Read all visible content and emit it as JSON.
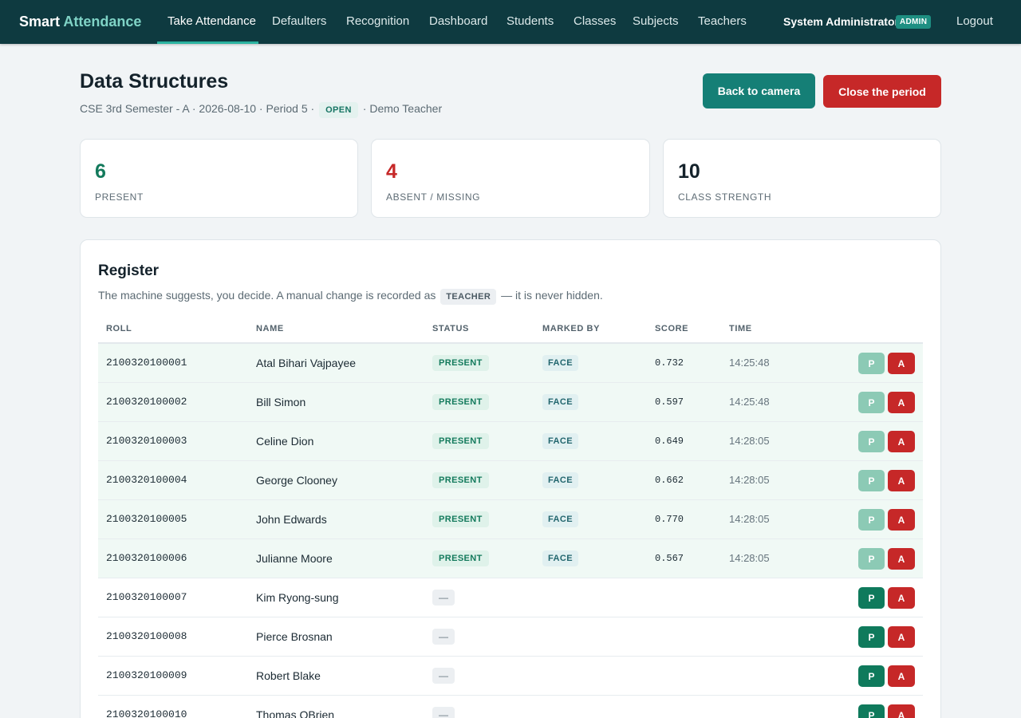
{
  "brand": {
    "name_part1": "Smart",
    "name_part2": "Attendance"
  },
  "nav": {
    "items": [
      {
        "label": "Take Attendance",
        "active": true
      },
      {
        "label": "Defaulters"
      },
      {
        "label": "Recognition"
      },
      {
        "label": "Dashboard"
      },
      {
        "label": "Students"
      },
      {
        "label": "Classes"
      },
      {
        "label": "Subjects"
      },
      {
        "label": "Teachers"
      }
    ],
    "user_name": "System Administrator",
    "role": "ADMIN",
    "logout": "Logout"
  },
  "session": {
    "subject": "Data Structures",
    "class_name": "CSE 3rd Semester - A",
    "date": "2026-08-10",
    "period": "Period 5",
    "status": "OPEN",
    "teacher": "Demo Teacher",
    "sep": "·"
  },
  "actions": {
    "back_to_camera": "Back to camera",
    "close_period": "Close the period"
  },
  "stats": {
    "present": {
      "value": "6",
      "label": "PRESENT"
    },
    "absent": {
      "value": "4",
      "label": "ABSENT / MISSING"
    },
    "strength": {
      "value": "10",
      "label": "CLASS STRENGTH"
    }
  },
  "register": {
    "title": "Register",
    "subtitle_before": "The machine suggests, you decide. A manual change is recorded as",
    "subtitle_badge": "TEACHER",
    "subtitle_after": "— it is never hidden.",
    "columns": {
      "roll": "ROLL",
      "name": "NAME",
      "status": "STATUS",
      "marked_by": "MARKED BY",
      "score": "SCORE",
      "time": "TIME"
    },
    "button_present": "P",
    "button_absent": "A",
    "empty_status": "—",
    "rows": [
      {
        "roll": "2100320100001",
        "name": "Atal Bihari Vajpayee",
        "status": "PRESENT",
        "marked_by": "FACE",
        "score": "0.732",
        "time": "14:25:48"
      },
      {
        "roll": "2100320100002",
        "name": "Bill Simon",
        "status": "PRESENT",
        "marked_by": "FACE",
        "score": "0.597",
        "time": "14:25:48"
      },
      {
        "roll": "2100320100003",
        "name": "Celine Dion",
        "status": "PRESENT",
        "marked_by": "FACE",
        "score": "0.649",
        "time": "14:28:05"
      },
      {
        "roll": "2100320100004",
        "name": "George Clooney",
        "status": "PRESENT",
        "marked_by": "FACE",
        "score": "0.662",
        "time": "14:28:05"
      },
      {
        "roll": "2100320100005",
        "name": "John Edwards",
        "status": "PRESENT",
        "marked_by": "FACE",
        "score": "0.770",
        "time": "14:28:05"
      },
      {
        "roll": "2100320100006",
        "name": "Julianne Moore",
        "status": "PRESENT",
        "marked_by": "FACE",
        "score": "0.567",
        "time": "14:28:05"
      },
      {
        "roll": "2100320100007",
        "name": "Kim Ryong-sung",
        "status": "",
        "marked_by": "",
        "score": "",
        "time": ""
      },
      {
        "roll": "2100320100008",
        "name": "Pierce Brosnan",
        "status": "",
        "marked_by": "",
        "score": "",
        "time": ""
      },
      {
        "roll": "2100320100009",
        "name": "Robert Blake",
        "status": "",
        "marked_by": "",
        "score": "",
        "time": ""
      },
      {
        "roll": "2100320100010",
        "name": "Thomas OBrien",
        "status": "",
        "marked_by": "",
        "score": "",
        "time": ""
      }
    ]
  },
  "colors": {
    "nav_bg": "#0e3a40",
    "accent": "#2bb3a0",
    "present_green": "#137a5c",
    "absent_red": "#c62828",
    "teal_button": "#157f76"
  }
}
